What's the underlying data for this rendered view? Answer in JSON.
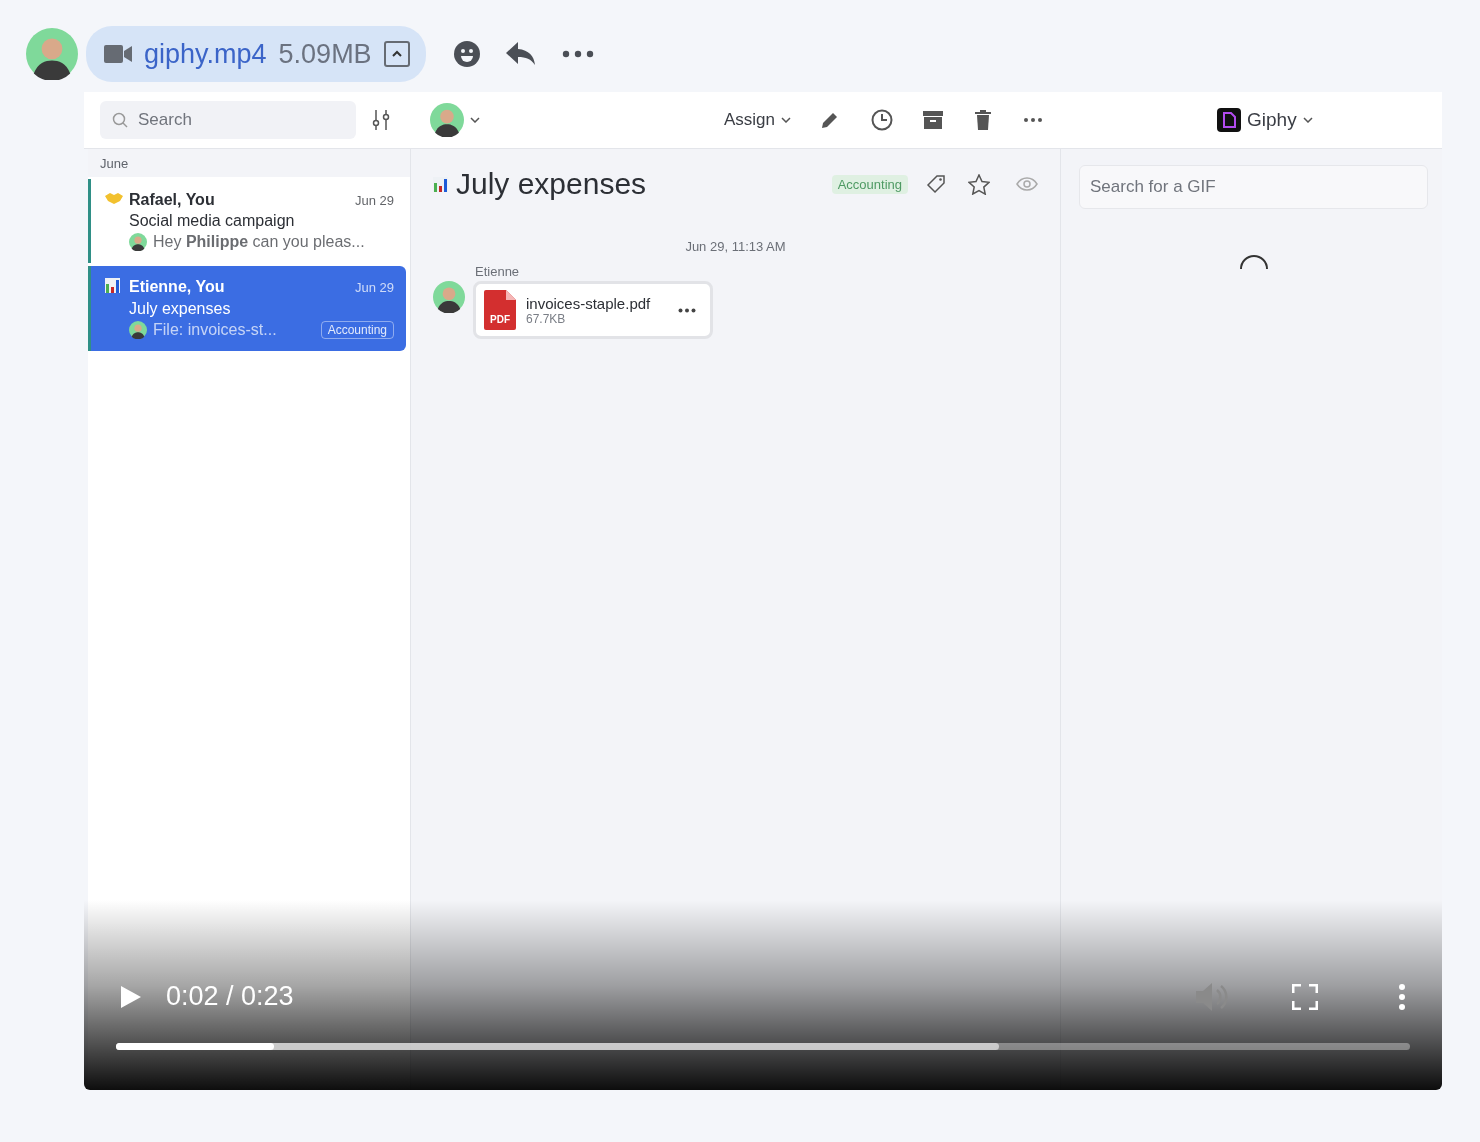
{
  "message": {
    "attachment": {
      "name": "giphy.mp4",
      "size": "5.09MB"
    }
  },
  "video": {
    "app": {
      "toolbar": {
        "search": {
          "placeholder": "Search"
        },
        "assign": "Assign",
        "integration": "Giphy"
      },
      "sidebar": {
        "section": "June",
        "conversations": [
          {
            "kind": "handshake",
            "participants": "Rafael, You",
            "date": "Jun 29",
            "subject": "Social media campaign",
            "preview": "Hey **Philippe** can you pleas...",
            "selected": false
          },
          {
            "kind": "chart",
            "participants": "Etienne, You",
            "date": "Jun 29",
            "subject": "July expenses",
            "preview": "File: invoices-st...",
            "tag": "Accounting",
            "selected": true
          }
        ]
      },
      "conversation": {
        "title": "July expenses",
        "tag": "Accounting",
        "timestamp": "Jun 29, 11:13 AM",
        "sender": "Etienne",
        "file": {
          "name": "invoices-staple.pdf",
          "size": "67.7KB",
          "type": "PDF"
        }
      },
      "gif_panel": {
        "search": {
          "placeholder": "Search for a GIF"
        }
      }
    },
    "player": {
      "time": "0:02 / 0:23",
      "progress": {
        "level": 0.122
      },
      "buffer": {
        "level": 0.682
      }
    }
  }
}
